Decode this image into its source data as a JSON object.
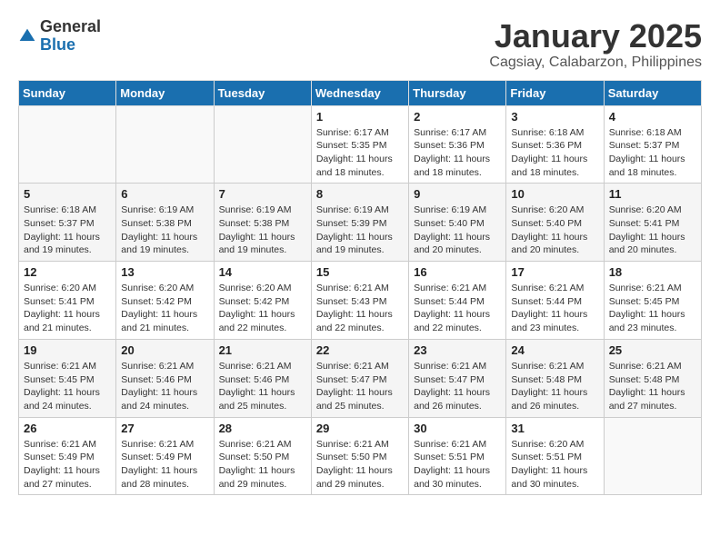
{
  "header": {
    "logo_general": "General",
    "logo_blue": "Blue",
    "month_title": "January 2025",
    "location": "Cagsiay, Calabarzon, Philippines"
  },
  "weekdays": [
    "Sunday",
    "Monday",
    "Tuesday",
    "Wednesday",
    "Thursday",
    "Friday",
    "Saturday"
  ],
  "weeks": [
    [
      {
        "day": "",
        "info": ""
      },
      {
        "day": "",
        "info": ""
      },
      {
        "day": "",
        "info": ""
      },
      {
        "day": "1",
        "info": "Sunrise: 6:17 AM\nSunset: 5:35 PM\nDaylight: 11 hours\nand 18 minutes."
      },
      {
        "day": "2",
        "info": "Sunrise: 6:17 AM\nSunset: 5:36 PM\nDaylight: 11 hours\nand 18 minutes."
      },
      {
        "day": "3",
        "info": "Sunrise: 6:18 AM\nSunset: 5:36 PM\nDaylight: 11 hours\nand 18 minutes."
      },
      {
        "day": "4",
        "info": "Sunrise: 6:18 AM\nSunset: 5:37 PM\nDaylight: 11 hours\nand 18 minutes."
      }
    ],
    [
      {
        "day": "5",
        "info": "Sunrise: 6:18 AM\nSunset: 5:37 PM\nDaylight: 11 hours\nand 19 minutes."
      },
      {
        "day": "6",
        "info": "Sunrise: 6:19 AM\nSunset: 5:38 PM\nDaylight: 11 hours\nand 19 minutes."
      },
      {
        "day": "7",
        "info": "Sunrise: 6:19 AM\nSunset: 5:38 PM\nDaylight: 11 hours\nand 19 minutes."
      },
      {
        "day": "8",
        "info": "Sunrise: 6:19 AM\nSunset: 5:39 PM\nDaylight: 11 hours\nand 19 minutes."
      },
      {
        "day": "9",
        "info": "Sunrise: 6:19 AM\nSunset: 5:40 PM\nDaylight: 11 hours\nand 20 minutes."
      },
      {
        "day": "10",
        "info": "Sunrise: 6:20 AM\nSunset: 5:40 PM\nDaylight: 11 hours\nand 20 minutes."
      },
      {
        "day": "11",
        "info": "Sunrise: 6:20 AM\nSunset: 5:41 PM\nDaylight: 11 hours\nand 20 minutes."
      }
    ],
    [
      {
        "day": "12",
        "info": "Sunrise: 6:20 AM\nSunset: 5:41 PM\nDaylight: 11 hours\nand 21 minutes."
      },
      {
        "day": "13",
        "info": "Sunrise: 6:20 AM\nSunset: 5:42 PM\nDaylight: 11 hours\nand 21 minutes."
      },
      {
        "day": "14",
        "info": "Sunrise: 6:20 AM\nSunset: 5:42 PM\nDaylight: 11 hours\nand 22 minutes."
      },
      {
        "day": "15",
        "info": "Sunrise: 6:21 AM\nSunset: 5:43 PM\nDaylight: 11 hours\nand 22 minutes."
      },
      {
        "day": "16",
        "info": "Sunrise: 6:21 AM\nSunset: 5:44 PM\nDaylight: 11 hours\nand 22 minutes."
      },
      {
        "day": "17",
        "info": "Sunrise: 6:21 AM\nSunset: 5:44 PM\nDaylight: 11 hours\nand 23 minutes."
      },
      {
        "day": "18",
        "info": "Sunrise: 6:21 AM\nSunset: 5:45 PM\nDaylight: 11 hours\nand 23 minutes."
      }
    ],
    [
      {
        "day": "19",
        "info": "Sunrise: 6:21 AM\nSunset: 5:45 PM\nDaylight: 11 hours\nand 24 minutes."
      },
      {
        "day": "20",
        "info": "Sunrise: 6:21 AM\nSunset: 5:46 PM\nDaylight: 11 hours\nand 24 minutes."
      },
      {
        "day": "21",
        "info": "Sunrise: 6:21 AM\nSunset: 5:46 PM\nDaylight: 11 hours\nand 25 minutes."
      },
      {
        "day": "22",
        "info": "Sunrise: 6:21 AM\nSunset: 5:47 PM\nDaylight: 11 hours\nand 25 minutes."
      },
      {
        "day": "23",
        "info": "Sunrise: 6:21 AM\nSunset: 5:47 PM\nDaylight: 11 hours\nand 26 minutes."
      },
      {
        "day": "24",
        "info": "Sunrise: 6:21 AM\nSunset: 5:48 PM\nDaylight: 11 hours\nand 26 minutes."
      },
      {
        "day": "25",
        "info": "Sunrise: 6:21 AM\nSunset: 5:48 PM\nDaylight: 11 hours\nand 27 minutes."
      }
    ],
    [
      {
        "day": "26",
        "info": "Sunrise: 6:21 AM\nSunset: 5:49 PM\nDaylight: 11 hours\nand 27 minutes."
      },
      {
        "day": "27",
        "info": "Sunrise: 6:21 AM\nSunset: 5:49 PM\nDaylight: 11 hours\nand 28 minutes."
      },
      {
        "day": "28",
        "info": "Sunrise: 6:21 AM\nSunset: 5:50 PM\nDaylight: 11 hours\nand 29 minutes."
      },
      {
        "day": "29",
        "info": "Sunrise: 6:21 AM\nSunset: 5:50 PM\nDaylight: 11 hours\nand 29 minutes."
      },
      {
        "day": "30",
        "info": "Sunrise: 6:21 AM\nSunset: 5:51 PM\nDaylight: 11 hours\nand 30 minutes."
      },
      {
        "day": "31",
        "info": "Sunrise: 6:20 AM\nSunset: 5:51 PM\nDaylight: 11 hours\nand 30 minutes."
      },
      {
        "day": "",
        "info": ""
      }
    ]
  ]
}
